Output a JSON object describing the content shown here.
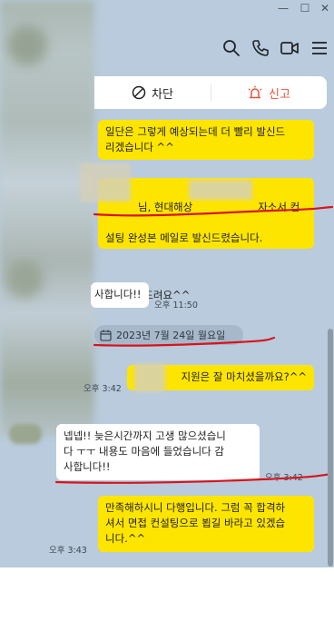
{
  "window_controls": {
    "minimize": "—",
    "maximize": "☐",
    "close": "✕"
  },
  "header": {
    "icons": [
      "search-icon",
      "phone-icon",
      "video-icon",
      "menu-icon"
    ]
  },
  "action_bar": {
    "block_label": "차단",
    "report_label": "신고"
  },
  "messages": {
    "m1": {
      "text": "일단은 그렇게 예상되는데 더 빨리 발신드\n리겠습니다 ^^"
    },
    "m2": {
      "line1a": "님, 현대해상",
      "line1b": "자소서 컨",
      "line2": "설팅 완성본 메일로 발신드렸습니다.",
      "line3": "확인부탁드려요^^"
    },
    "m3": {
      "text": "사합니다!!",
      "time": "오후 11:50"
    },
    "date": {
      "text": "2023년 7월 24일 월요일"
    },
    "m4": {
      "text": "지원은 잘 마치셨을까요?^^",
      "time": "오후 3:42"
    },
    "m5": {
      "text": "넵넵!! 늦은시간까지 고생 많으셨습니\n다 ㅜㅜ 내용도 마음에 들었습니다 감\n사합니다!!",
      "time": "오후 3:42"
    },
    "m6": {
      "text": "만족해하시니 다행입니다. 그럼 꼭 합격하\n셔서 면접 컨설팅으로 뵙길 바라고 있겠습\n니다.^^",
      "time": "오후 3:43"
    }
  },
  "colors": {
    "chat_bg": "#b9cbdc",
    "my_bubble": "#fee500",
    "their_bubble": "#ffffff",
    "report_red": "#e8553a",
    "annotation_red": "#d8131c"
  }
}
